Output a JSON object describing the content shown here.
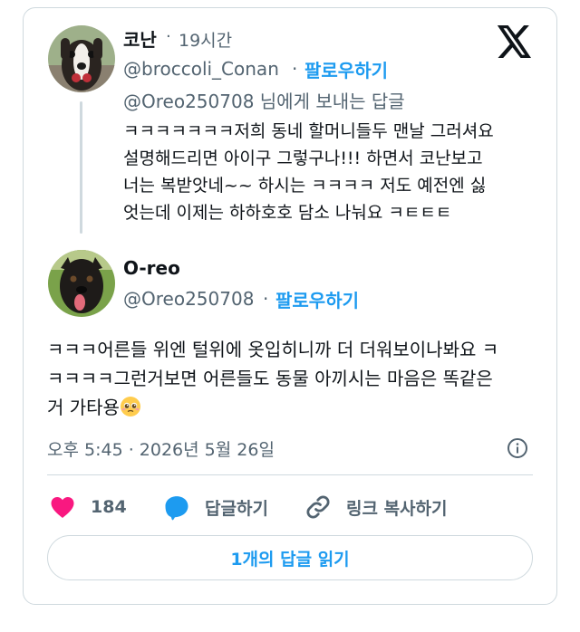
{
  "parent_tweet": {
    "name": "코난",
    "separator": "·",
    "time": "19시간",
    "handle": "@broccoli_Conan",
    "follow_label": "팔로우하기",
    "reply_context": "@Oreo250708 님에게 보내는 답글",
    "body_lines": [
      "ㅋㅋㅋㅋㅋㅋㅋ저희 동네 할머니들두 맨날 그러셔요",
      "설명해드리면 아이구 그렇구나!!! 하면서 코난보고",
      "너는 복받앗네~~ 하시는 ㅋㅋㅋㅋ 저도 예전엔 싫",
      "엇는데 이제는 하하호호 담소 나눠요 ㅋㅌㅌㅌ"
    ]
  },
  "main_tweet": {
    "name": "O-reo",
    "handle": "@Oreo250708",
    "separator": "·",
    "follow_label": "팔로우하기",
    "body_lines": [
      "ㅋㅋㅋ어른들 위엔 털위에 옷입히니까 더 더워보이나봐요 ㅋ",
      "ㅋㅋㅋㅋ그런거보면 어른들도 동물 아끼시는 마음은 똑같은",
      "거 가타용"
    ],
    "emoji": "pleading-face-icon",
    "meta": "오후 5:45 · 2026년 5월 26일"
  },
  "actions": {
    "like_count": "184",
    "reply_label": "답글하기",
    "copy_link_label": "링크 복사하기"
  },
  "read_replies_label": "1개의 답글 읽기",
  "colors": {
    "accent": "#1d9bf0",
    "like": "#f91880",
    "secondary_text": "#536471",
    "border": "#cfd9de"
  },
  "icons": [
    "x-logo-icon",
    "info-icon",
    "heart-icon",
    "reply-bubble-icon",
    "link-icon"
  ]
}
